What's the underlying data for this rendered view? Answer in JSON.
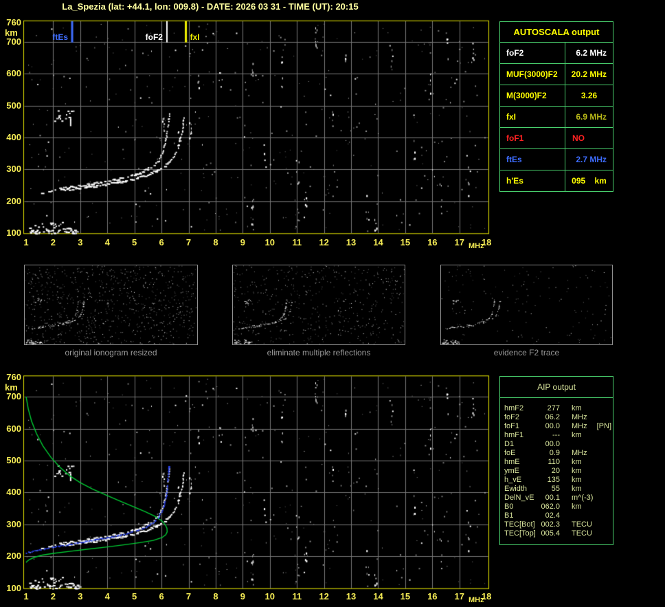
{
  "header": {
    "title": "La_Spezia (lat: +44.1, lon: 009.8) - DATE: 2026 03 31 - TIME (UT): 20:15"
  },
  "colors": {
    "background": "#000000",
    "title_text": "#ffffa0",
    "axis_text": "#f5ec55",
    "chart_border": "#e6e600",
    "grid": "#787878",
    "table_border": "#49d06d",
    "autoscala_header": "#ffff00",
    "autoscala_yellow": "#ffff00",
    "autoscala_white": "#ffffff",
    "fxi_value_olive": "#b8b818",
    "fof1_red": "#ff2222",
    "ftes_blue": "#3e6dff",
    "aip_text": "#d8e49c",
    "caption_gray": "#9a9a9a",
    "echo_white": "#ffffff",
    "profile_green": "#00cc33",
    "fitted_blue": "#2b42e8"
  },
  "autoscala_table": {
    "title": "AUTOSCALA output",
    "rows": [
      {
        "label": "foF2",
        "value": "6.2 MHz",
        "color": "#ffffff",
        "align": "right"
      },
      {
        "label": "MUF(3000)F2",
        "value": "20.2 MHz",
        "color": "#ffff00",
        "align": "right"
      },
      {
        "label": "M(3000)F2",
        "value": "3.26",
        "color": "#ffff00",
        "align": "center"
      },
      {
        "label": "fxI",
        "value": "6.9 MHz",
        "color": "#ffff00",
        "value_color": "#b8b818",
        "align": "right"
      },
      {
        "label": "foF1",
        "value": "NO",
        "color": "#ff2222",
        "align": "left"
      },
      {
        "label": "ftEs",
        "value": "2.7 MHz",
        "color": "#3e6dff",
        "align": "right"
      },
      {
        "label": "h'Es",
        "value": "095    km",
        "color": "#ffff00",
        "align": "center"
      }
    ]
  },
  "thumbnails": [
    {
      "caption": "original ionogram resized"
    },
    {
      "caption": "eliminate multiple reflections"
    },
    {
      "caption": "evidence F2 trace"
    }
  ],
  "aip_table": {
    "title": "AIP output",
    "rows": [
      {
        "name": "hmF2",
        "value": "277",
        "unit": "km",
        "note": ""
      },
      {
        "name": "foF2",
        "value": "06.2",
        "unit": "MHz",
        "note": ""
      },
      {
        "name": "foF1",
        "value": "00.0",
        "unit": "MHz",
        "note": "[PN]"
      },
      {
        "name": "hmF1",
        "value": "---",
        "unit": "km",
        "note": ""
      },
      {
        "name": "D1",
        "value": "00.0",
        "unit": "",
        "note": ""
      },
      {
        "name": "foE",
        "value": "0.9",
        "unit": "MHz",
        "note": ""
      },
      {
        "name": "hmE",
        "value": "110",
        "unit": "km",
        "note": ""
      },
      {
        "name": "ymE",
        "value": "20",
        "unit": "km",
        "note": ""
      },
      {
        "name": "h_vE",
        "value": "135",
        "unit": "km",
        "note": ""
      },
      {
        "name": "Ewidth",
        "value": "55",
        "unit": "km",
        "note": ""
      },
      {
        "name": "DelN_vE",
        "value": "00.1",
        "unit": "m^(-3)",
        "note": ""
      },
      {
        "name": "B0",
        "value": "062.0",
        "unit": "km",
        "note": ""
      },
      {
        "name": "B1",
        "value": "02.4",
        "unit": "",
        "note": ""
      },
      {
        "name": "TEC[Bot]",
        "value": "002.3",
        "unit": "TECU",
        "note": ""
      },
      {
        "name": "TEC[Top]",
        "value": "005.4",
        "unit": "TECU",
        "note": ""
      }
    ]
  },
  "chart_data": [
    {
      "type": "scatter",
      "name": "scaled ionogram with characteristic frequency markers",
      "xlabel": "MHz",
      "ylabel": "km",
      "xlim": [
        1,
        18
      ],
      "ylim": [
        100,
        760
      ],
      "xticks": [
        1,
        2,
        3,
        4,
        5,
        6,
        7,
        8,
        9,
        10,
        11,
        12,
        13,
        14,
        15,
        16,
        17,
        18
      ],
      "yticks": [
        760,
        700,
        600,
        500,
        400,
        300,
        200,
        100
      ],
      "grid": true,
      "markers": [
        {
          "label": "ftEs",
          "freq_mhz": 2.7,
          "color": "#3e6dff"
        },
        {
          "label": "foF2",
          "freq_mhz": 6.2,
          "color": "#ffffff"
        },
        {
          "label": "fxI",
          "freq_mhz": 6.9,
          "color": "#f2f200"
        }
      ],
      "series": [
        {
          "name": "O-mode F trace",
          "color": "#ffffff",
          "points": [
            [
              1.55,
              228
            ],
            [
              1.8,
              233
            ],
            [
              2.1,
              239
            ],
            [
              2.5,
              245
            ],
            [
              2.9,
              250
            ],
            [
              3.3,
              255
            ],
            [
              3.7,
              261
            ],
            [
              4.1,
              267
            ],
            [
              4.5,
              274
            ],
            [
              4.85,
              282
            ],
            [
              5.15,
              291
            ],
            [
              5.45,
              302
            ],
            [
              5.7,
              315
            ],
            [
              5.88,
              330
            ],
            [
              6.0,
              349
            ],
            [
              6.08,
              370
            ],
            [
              6.14,
              394
            ],
            [
              6.19,
              420
            ],
            [
              6.23,
              447
            ],
            [
              6.26,
              468
            ],
            [
              6.28,
              482
            ]
          ]
        },
        {
          "name": "X-mode F trace",
          "color": "#ffffff",
          "points": [
            [
              2.3,
              236
            ],
            [
              2.8,
              241
            ],
            [
              3.3,
              246
            ],
            [
              3.8,
              252
            ],
            [
              4.25,
              259
            ],
            [
              4.65,
              266
            ],
            [
              5.05,
              274
            ],
            [
              5.4,
              284
            ],
            [
              5.75,
              296
            ],
            [
              6.05,
              310
            ],
            [
              6.3,
              327
            ],
            [
              6.48,
              347
            ],
            [
              6.6,
              370
            ],
            [
              6.68,
              394
            ],
            [
              6.74,
              420
            ],
            [
              6.78,
              447
            ],
            [
              6.81,
              470
            ]
          ]
        },
        {
          "name": "sporadic-E layer",
          "color": "#ffffff",
          "f_range": [
            1.05,
            2.85
          ],
          "h_range": [
            100,
            118
          ],
          "n_points": 55
        },
        {
          "name": "sporadic-E upper scatter",
          "color": "#ffffff",
          "f_range": [
            1.1,
            2.4
          ],
          "h_range": [
            118,
            136
          ],
          "n_points": 14
        },
        {
          "name": "second-hop cluster",
          "color": "#ffffff",
          "f_range": [
            2.0,
            2.7
          ],
          "h_range": [
            438,
            486
          ],
          "n_points": 14
        }
      ]
    },
    {
      "type": "scatter",
      "name": "ionogram with AIP electron density profile and fitted trace",
      "xlabel": "MHz",
      "ylabel": "km",
      "xlim": [
        1,
        18
      ],
      "ylim": [
        100,
        760
      ],
      "xticks": [
        1,
        2,
        3,
        4,
        5,
        6,
        7,
        8,
        9,
        10,
        11,
        12,
        13,
        14,
        15,
        16,
        17,
        18
      ],
      "yticks": [
        760,
        700,
        600,
        500,
        400,
        300,
        200,
        100
      ],
      "grid": true,
      "series": [
        {
          "name": "O-mode F trace",
          "color": "#ffffff",
          "points": [
            [
              1.55,
              228
            ],
            [
              1.8,
              233
            ],
            [
              2.1,
              239
            ],
            [
              2.5,
              245
            ],
            [
              2.9,
              250
            ],
            [
              3.3,
              255
            ],
            [
              3.7,
              261
            ],
            [
              4.1,
              267
            ],
            [
              4.5,
              274
            ],
            [
              4.85,
              282
            ],
            [
              5.15,
              291
            ],
            [
              5.45,
              302
            ],
            [
              5.7,
              315
            ],
            [
              5.88,
              330
            ],
            [
              6.0,
              349
            ],
            [
              6.08,
              370
            ],
            [
              6.14,
              394
            ],
            [
              6.19,
              420
            ],
            [
              6.23,
              447
            ],
            [
              6.26,
              468
            ],
            [
              6.28,
              482
            ]
          ]
        },
        {
          "name": "X-mode F trace",
          "color": "#ffffff",
          "points": [
            [
              2.3,
              236
            ],
            [
              2.8,
              241
            ],
            [
              3.3,
              246
            ],
            [
              3.8,
              252
            ],
            [
              4.25,
              259
            ],
            [
              4.65,
              266
            ],
            [
              5.05,
              274
            ],
            [
              5.4,
              284
            ],
            [
              5.75,
              296
            ],
            [
              6.05,
              310
            ],
            [
              6.3,
              327
            ],
            [
              6.48,
              347
            ],
            [
              6.6,
              370
            ],
            [
              6.68,
              394
            ],
            [
              6.74,
              420
            ],
            [
              6.78,
              447
            ],
            [
              6.81,
              470
            ]
          ]
        },
        {
          "name": "sporadic-E layer",
          "color": "#ffffff",
          "f_range": [
            1.05,
            2.95
          ],
          "h_range": [
            100,
            118
          ],
          "n_points": 55
        },
        {
          "name": "sporadic-E upper scatter",
          "color": "#ffffff",
          "f_range": [
            1.1,
            2.4
          ],
          "h_range": [
            118,
            136
          ],
          "n_points": 14
        },
        {
          "name": "second-hop cluster",
          "color": "#ffffff",
          "f_range": [
            2.0,
            2.7
          ],
          "h_range": [
            438,
            486
          ],
          "n_points": 14
        }
      ],
      "profile": {
        "name": "electron density profile (plasma frequency vs height)",
        "color": "#00cc33",
        "peak": {
          "foF2_mhz": 6.2,
          "hmF2_km": 277
        },
        "points": [
          [
            1.0,
            700
          ],
          [
            1.08,
            662
          ],
          [
            1.2,
            624
          ],
          [
            1.38,
            585
          ],
          [
            1.62,
            546
          ],
          [
            1.92,
            510
          ],
          [
            2.25,
            479
          ],
          [
            2.62,
            452
          ],
          [
            3.0,
            431
          ],
          [
            3.45,
            411
          ],
          [
            3.95,
            392
          ],
          [
            4.45,
            374
          ],
          [
            4.95,
            356
          ],
          [
            5.4,
            340
          ],
          [
            5.75,
            326
          ],
          [
            6.0,
            312
          ],
          [
            6.14,
            299
          ],
          [
            6.2,
            288
          ],
          [
            6.21,
            277
          ],
          [
            6.16,
            268
          ],
          [
            6.02,
            259
          ],
          [
            5.7,
            250
          ],
          [
            5.2,
            243
          ],
          [
            4.6,
            236
          ],
          [
            3.95,
            229
          ],
          [
            3.3,
            223
          ],
          [
            2.65,
            216
          ],
          [
            2.05,
            210
          ],
          [
            1.6,
            204
          ],
          [
            1.3,
            197
          ],
          [
            1.12,
            190
          ],
          [
            1.03,
            184
          ],
          [
            1.0,
            181
          ]
        ]
      },
      "fitted_trace": {
        "name": "synthetic trace from fitted profile",
        "color": "#2b42e8",
        "points": [
          [
            1.0,
            213
          ],
          [
            1.3,
            219
          ],
          [
            1.65,
            225
          ],
          [
            2.05,
            231
          ],
          [
            2.45,
            237
          ],
          [
            2.85,
            243
          ],
          [
            3.25,
            249
          ],
          [
            3.65,
            255
          ],
          [
            4.05,
            261
          ],
          [
            4.45,
            268
          ],
          [
            4.8,
            275
          ],
          [
            5.1,
            283
          ],
          [
            5.4,
            293
          ],
          [
            5.65,
            306
          ],
          [
            5.85,
            322
          ],
          [
            6.0,
            342
          ],
          [
            6.09,
            364
          ],
          [
            6.15,
            388
          ],
          [
            6.19,
            414
          ],
          [
            6.22,
            441
          ],
          [
            6.24,
            464
          ],
          [
            6.25,
            483
          ]
        ]
      }
    }
  ]
}
